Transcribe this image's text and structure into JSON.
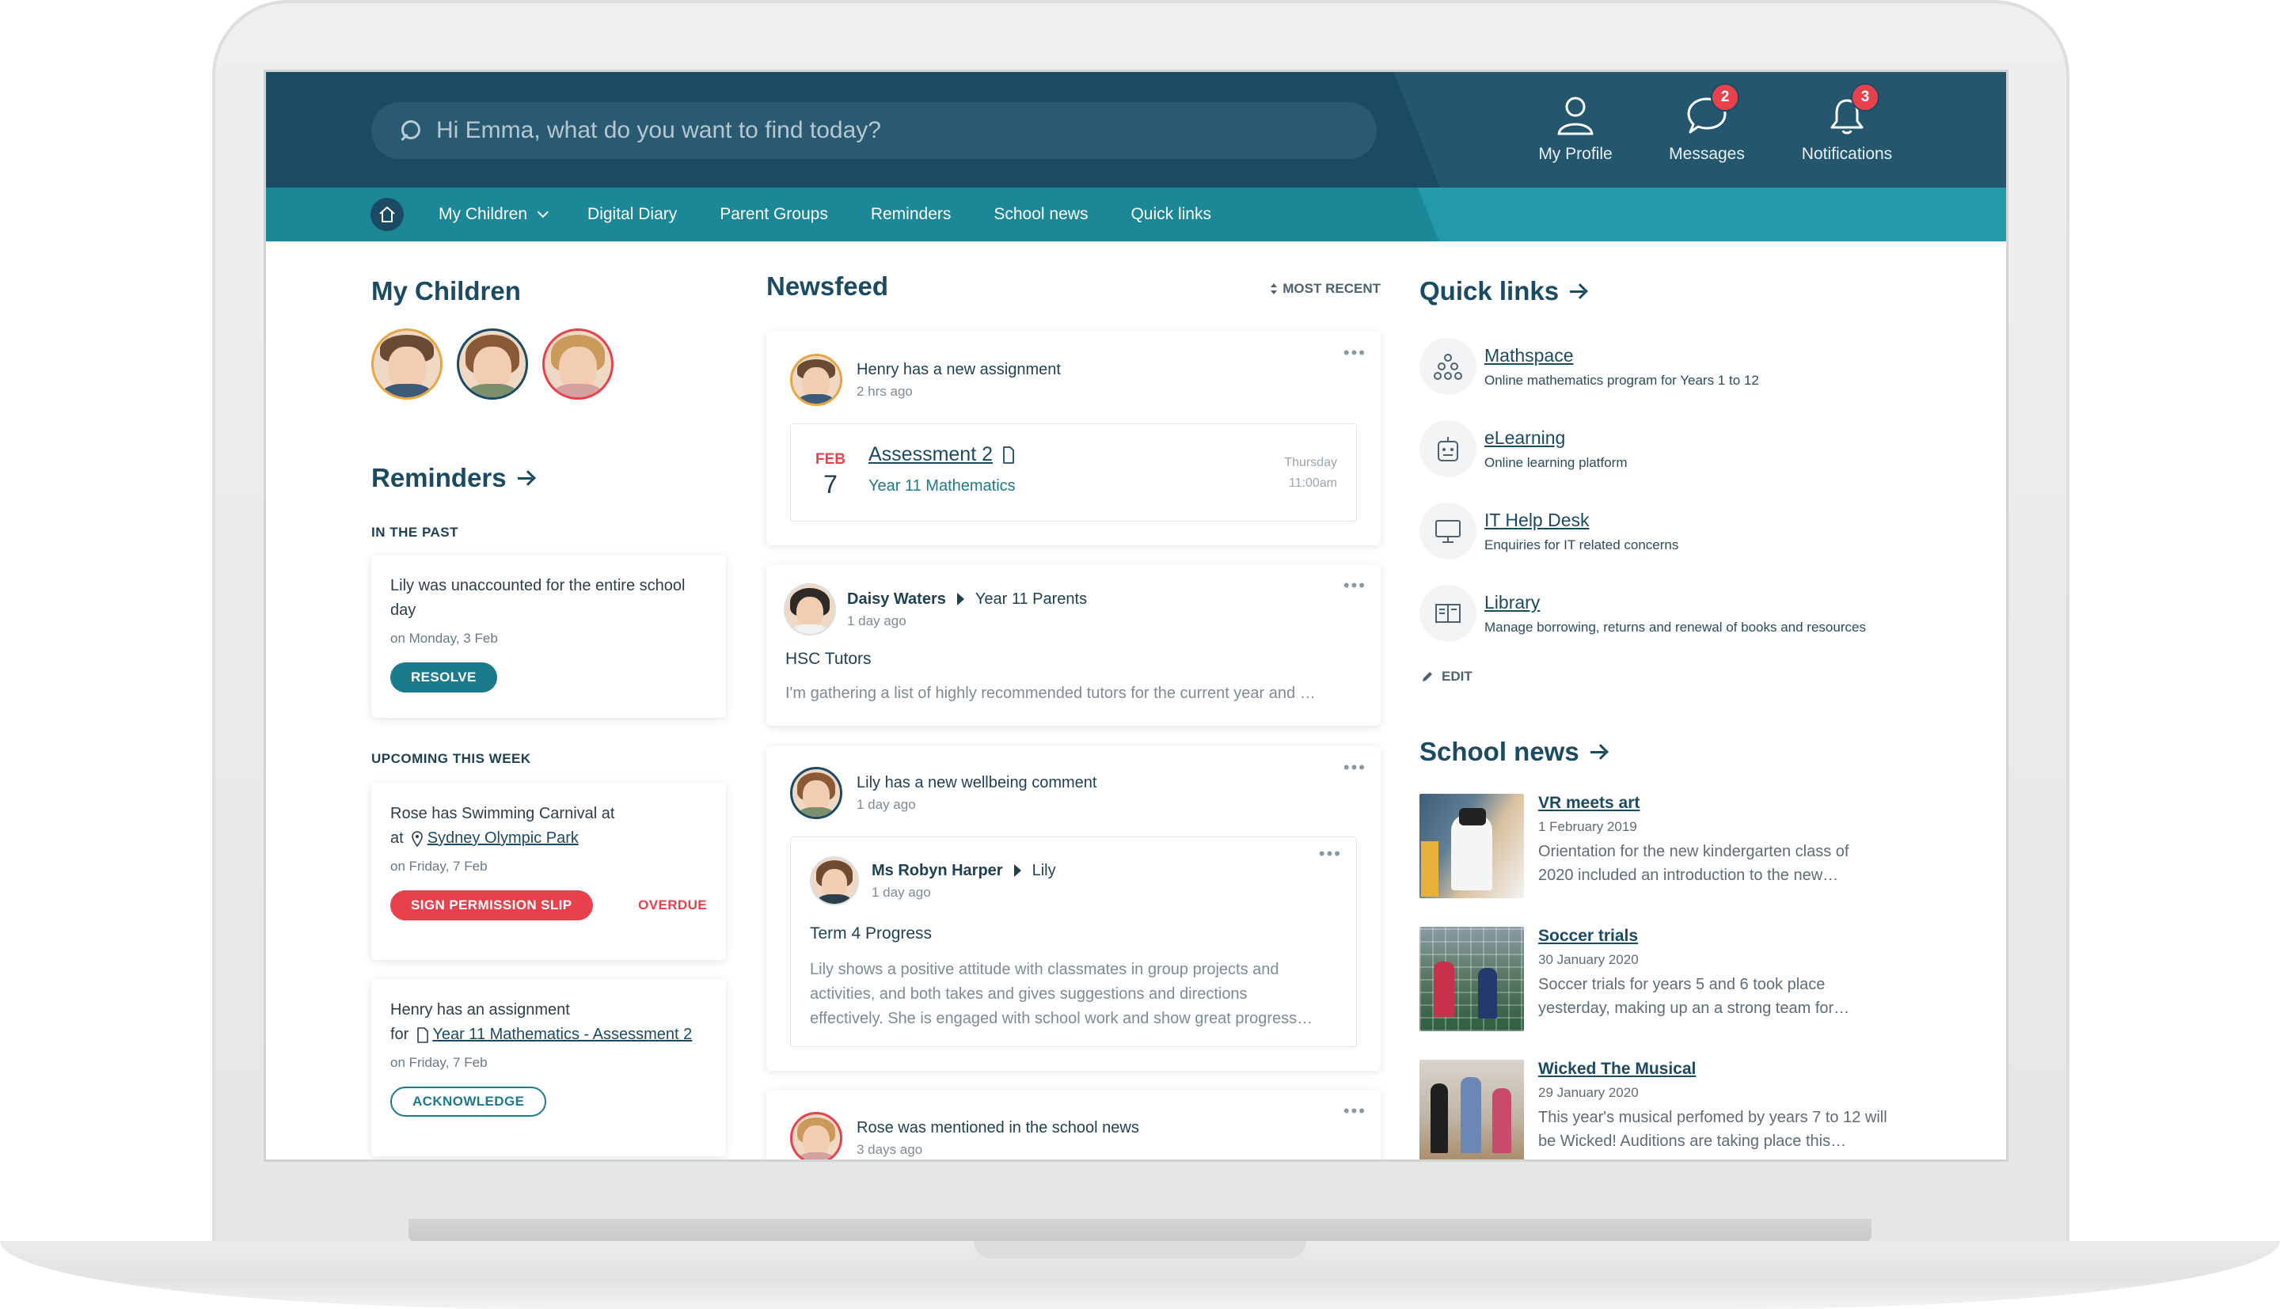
{
  "search": {
    "placeholder": "Hi Emma, what do you want to find today?"
  },
  "top_actions": {
    "profile": {
      "label": "My Profile"
    },
    "messages": {
      "label": "Messages",
      "badge": "2"
    },
    "notifications": {
      "label": "Notifications",
      "badge": "3"
    }
  },
  "nav": {
    "items": [
      "My Children",
      "Digital Diary",
      "Parent Groups",
      "Reminders",
      "School news",
      "Quick links"
    ]
  },
  "my_children": {
    "title": "My Children"
  },
  "reminders": {
    "title": "Reminders",
    "past_label": "IN THE PAST",
    "upcoming_label": "UPCOMING THIS WEEK",
    "items": [
      {
        "text": "Lily was unaccounted for the entire school day",
        "date": "on Monday, 3 Feb",
        "action": "RESOLVE"
      },
      {
        "text": "Rose has Swimming Carnival at",
        "prefix": "at",
        "link": "Sydney Olympic Park",
        "date": "on Friday, 7 Feb",
        "action": "SIGN PERMISSION SLIP",
        "status": "OVERDUE"
      },
      {
        "text": "Henry has an assignment",
        "prefix": "for",
        "link": "Year 11 Mathematics - Assessment 2",
        "date": "on Friday, 7 Feb",
        "action": "ACKNOWLEDGE"
      }
    ]
  },
  "newsfeed": {
    "title": "Newsfeed",
    "sort": "MOST RECENT",
    "posts": [
      {
        "title": "Henry has a new assignment",
        "time": "2 hrs ago",
        "assignment": {
          "month": "FEB",
          "day": "7",
          "name": "Assessment 2",
          "subject": "Year 11 Mathematics",
          "weekday": "Thursday",
          "time": "11:00am"
        }
      },
      {
        "author": "Daisy Waters",
        "group": "Year 11 Parents",
        "time": "1 day ago",
        "subject": "HSC Tutors",
        "excerpt": "I'm gathering a list of highly recommended tutors for the current year and …"
      },
      {
        "title": "Lily has a new wellbeing comment",
        "time": "1 day ago",
        "comment": {
          "author": "Ms Robyn Harper",
          "student": "Lily",
          "time": "1 day ago",
          "subject": "Term 4 Progress",
          "lines": [
            "Lily shows a positive attitude with classmates in group projects and",
            "activities, and both takes and gives suggestions and directions",
            "effectively. She is engaged with school work and show great progress…"
          ]
        }
      },
      {
        "title": "Rose was mentioned in the school news",
        "time": "3 days ago"
      }
    ]
  },
  "quick_links": {
    "title": "Quick links",
    "edit_label": "EDIT",
    "items": [
      {
        "title": "Mathspace",
        "desc": "Online mathematics program for Years 1 to 12",
        "icon": "abacus-icon"
      },
      {
        "title": "eLearning",
        "desc": "Online learning platform",
        "icon": "robot-icon"
      },
      {
        "title": "IT Help Desk",
        "desc": "Enquiries for IT related concerns",
        "icon": "monitor-icon"
      },
      {
        "title": "Library",
        "desc": "Manage borrowing, returns and renewal of books and resources",
        "icon": "book-icon"
      }
    ]
  },
  "school_news": {
    "title": "School news",
    "items": [
      {
        "title": "VR meets art",
        "date": "1 February 2019",
        "lines": [
          "Orientation for the new kindergarten class of",
          "2020 included an introduction to the new…"
        ]
      },
      {
        "title": "Soccer trials",
        "date": "30 January 2020",
        "lines": [
          "Soccer trials for years 5 and 6 took place",
          "yesterday, making up an a strong team for…"
        ]
      },
      {
        "title": "Wicked The Musical",
        "date": "29 January 2020",
        "lines": [
          "This year's musical perfomed by years 7 to 12 will",
          "be Wicked! Auditions are taking place this…"
        ]
      }
    ]
  },
  "colors": {
    "header_dark": "#1b4a63",
    "nav_teal": "#1b8797",
    "accent_red": "#e8414c",
    "accent_teal": "#1b7a8c"
  }
}
